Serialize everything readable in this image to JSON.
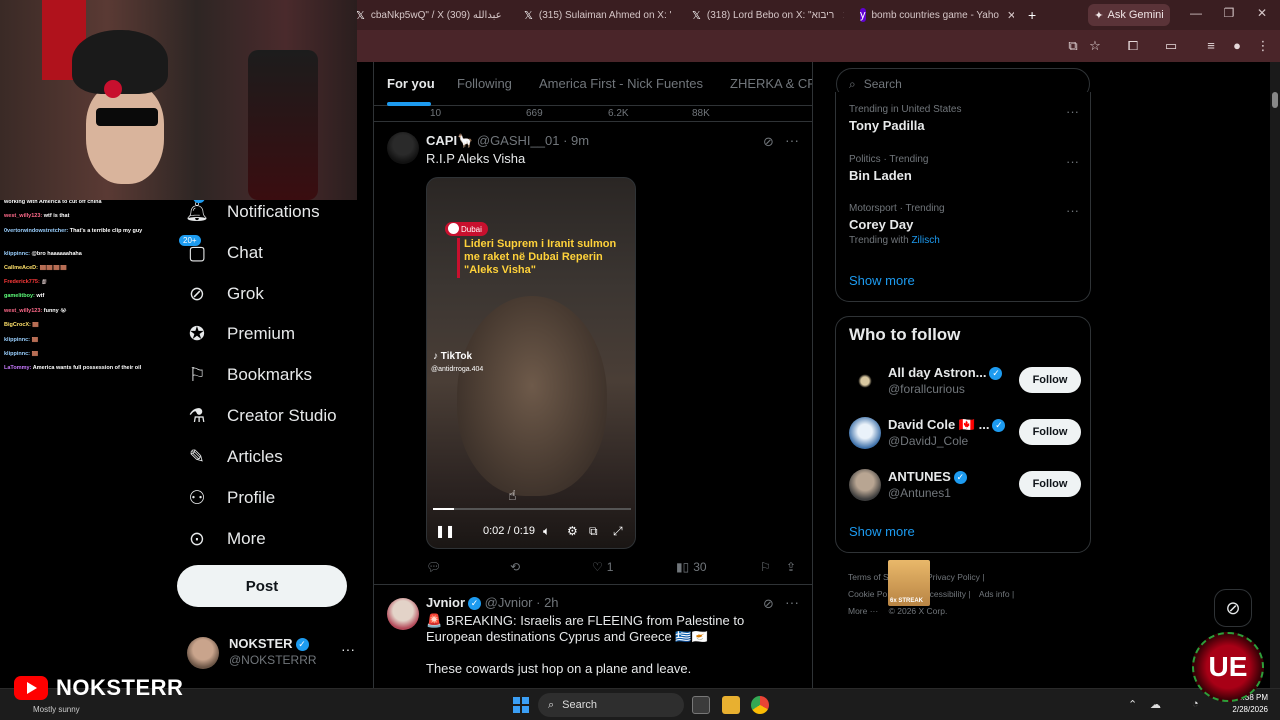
{
  "browser": {
    "tabs": [
      {
        "label": "cbaNkp5wQ\" / X عبدالله (309)",
        "icon": "x-logo-icon"
      },
      {
        "label": "(315) Sulaiman Ahmed on X: '",
        "icon": "x-logo-icon"
      },
      {
        "label": "(318) Lord Bebo on X: \"ריבוא",
        "icon": "x-logo-icon"
      },
      {
        "label": "bomb countries game - Yaho",
        "icon": "yahoo-icon"
      }
    ],
    "new_tab": "+",
    "ask_gemini": "Ask Gemini",
    "window": {
      "minimize": "—",
      "restore": "❐",
      "close": "✕"
    }
  },
  "nav": {
    "items": [
      {
        "label": "Notifications",
        "icon": "bell-icon",
        "badge": "5"
      },
      {
        "label": "Chat",
        "icon": "chat-icon",
        "badge": "20+"
      },
      {
        "label": "Grok",
        "icon": "grok-icon"
      },
      {
        "label": "Premium",
        "icon": "premium-icon"
      },
      {
        "label": "Bookmarks",
        "icon": "bookmark-icon"
      },
      {
        "label": "Creator Studio",
        "icon": "flask-icon"
      },
      {
        "label": "Articles",
        "icon": "articles-icon"
      },
      {
        "label": "Profile",
        "icon": "person-icon"
      },
      {
        "label": "More",
        "icon": "more-circle-icon"
      }
    ],
    "post_label": "Post",
    "account": {
      "name": "NOKSTER",
      "handle": "@NOKSTERRR",
      "more": "···"
    }
  },
  "chat_overlay": [
    {
      "user": "",
      "text": "working with America to cut off china"
    },
    {
      "user": "west_willy123:",
      "text": " wtf is that"
    },
    {
      "user": "0vertorwindowstretcher:",
      "text": " That's a terrible clip my guy"
    },
    {
      "user": "klippinnc:",
      "text": " @bro haaaaaahaha"
    },
    {
      "user": "CallmeAceD:",
      "text": " 🟫🟫🟫🟫"
    },
    {
      "user": "Frederick775:",
      "text": " 🗿"
    },
    {
      "user": "gamelitboy:",
      "text": " wtf"
    },
    {
      "user": "west_willy123:",
      "text": " funny 😭"
    },
    {
      "user": "BigCrocX:",
      "text": " 🟫"
    },
    {
      "user": "klippinnc:",
      "text": " 🟫"
    },
    {
      "user": "klippinnc:",
      "text": " 🟫"
    },
    {
      "user": "LaTommy:",
      "text": " America wants full possession of their oil"
    }
  ],
  "feed": {
    "tabs": [
      "For you",
      "Following",
      "America First - Nick Fuentes",
      "ZHERKA & CR"
    ],
    "active_tab": "For you",
    "prev_actions": {
      "replies": "10",
      "reposts": "669",
      "likes": "6.2K",
      "views": "88K"
    },
    "tweet1": {
      "name": "CAPI🦙",
      "handle": "@GASHI__01",
      "time": "· 9m",
      "text": "R.I.P Aleks Visha",
      "video": {
        "location_tag": "Dubai",
        "caption": "Lideri Suprem i Iranit sulmon me raket në Dubai Reperin \"Aleks Visha\"",
        "tiktok": "TikTok",
        "tiktok_handle": "@antidrroga.404",
        "time": "0:02 / 0:19",
        "progress": 0.105
      },
      "actions": {
        "replies": "",
        "reposts": "",
        "likes": "1",
        "views": "30"
      }
    },
    "tweet2": {
      "name": "Jvnior",
      "handle": "@Jvnior",
      "time": "· 2h",
      "text": "🚨 BREAKING: Israelis are FLEEING from Palestine to European destinations Cyprus and Greece 🇬🇷🇨🇾",
      "text2": "These cowards just hop on a plane and leave."
    }
  },
  "right": {
    "search_placeholder": "Search",
    "trends": [
      {
        "context": "Trending in United States",
        "title": "Tony Padilla",
        "sub": ""
      },
      {
        "context": "Politics · Trending",
        "title": "Bin Laden",
        "sub": ""
      },
      {
        "context": "Motorsport · Trending",
        "title": "Corey Day",
        "sub_prefix": "Trending with",
        "sub_link": "Zilisch"
      }
    ],
    "show_more": "Show more",
    "who_to_follow": "Who to follow",
    "follow": [
      {
        "name": "All day Astron...",
        "handle": "@forallcurious",
        "verified": true
      },
      {
        "name": "David Cole 🇨🇦 ...",
        "handle": "@DavidJ_Cole",
        "verified": true
      },
      {
        "name": "ANTUNES",
        "handle": "@Antunes1",
        "verified": true
      }
    ],
    "follow_label": "Follow",
    "footer": [
      "Terms of S",
      "Privacy Policy",
      "Cookie Po",
      "cessibility",
      "Ads info",
      "More ···",
      "© 2026 X Corp."
    ],
    "streak": "6x STREAK"
  },
  "overlay": {
    "youtube_name": "NOKSTERR",
    "weather": "Mostly sunny"
  },
  "taskbar": {
    "search": "Search",
    "time": "5:38 PM",
    "date": "2/28/2026"
  }
}
